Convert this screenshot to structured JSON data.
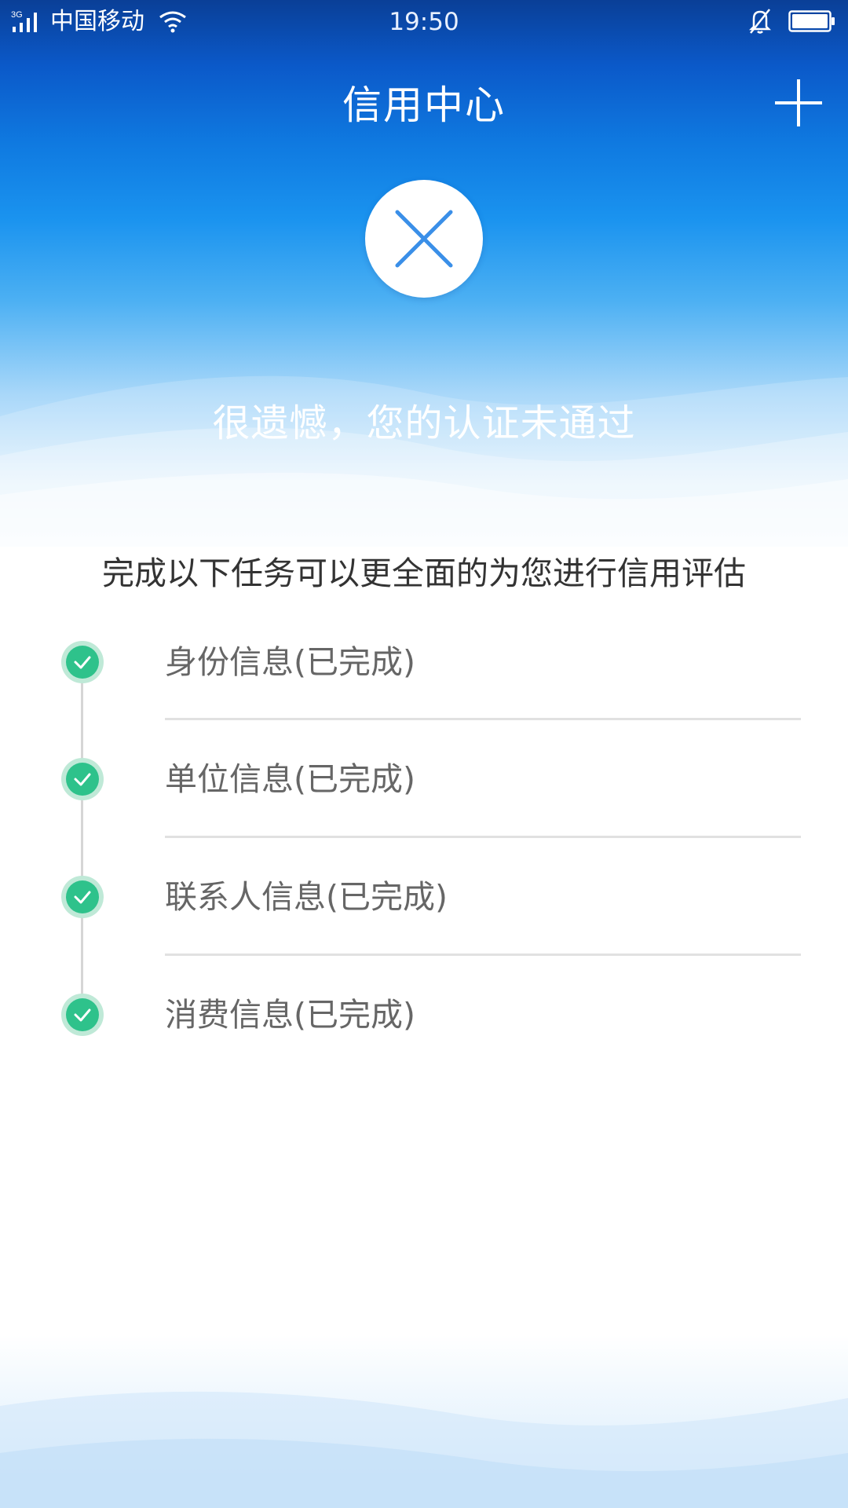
{
  "status_bar": {
    "network_type": "3G",
    "carrier": "中国移动",
    "time": "19:50",
    "icons": [
      "signal-icon",
      "wifi-icon",
      "bell-muted-icon",
      "battery-icon"
    ]
  },
  "header": {
    "title": "信用中心",
    "add_icon": "plus-icon"
  },
  "result": {
    "icon": "close-icon",
    "message": "很遗憾，您的认证未通过"
  },
  "tasks": {
    "intro": "完成以下任务可以更全面的为您进行信用评估",
    "items": [
      {
        "label": "身份信息(已完成)",
        "completed": true
      },
      {
        "label": "单位信息(已完成)",
        "completed": true
      },
      {
        "label": "联系人信息(已完成)",
        "completed": true
      },
      {
        "label": "消费信息(已完成)",
        "completed": true
      }
    ]
  },
  "colors": {
    "header_blue": "#0b59c9",
    "accent_blue": "#2f8ff0",
    "check_green": "#2ec28b",
    "text_dark": "#333333",
    "text_gray": "#666666"
  }
}
